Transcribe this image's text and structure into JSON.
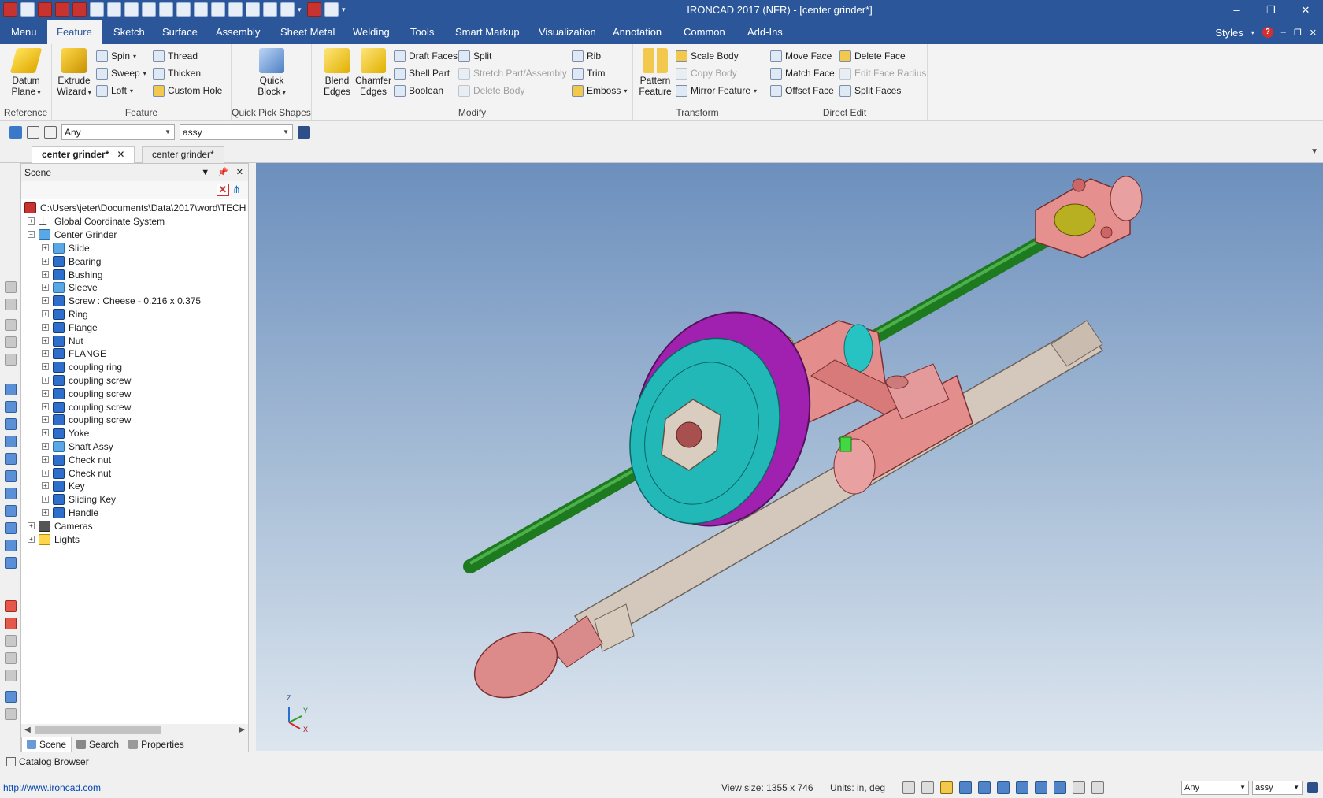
{
  "window": {
    "title": "IRONCAD 2017 (NFR) - [center grinder*]",
    "controls": [
      "–",
      "❐",
      "✕"
    ]
  },
  "ribbon_tabs": [
    "Menu",
    "Feature",
    "Sketch",
    "Surface",
    "Assembly",
    "Sheet Metal",
    "Welding",
    "Tools",
    "Smart Markup",
    "Visualization",
    "Annotation",
    "Common",
    "Add-Ins"
  ],
  "ribbon_right": {
    "styles": "Styles",
    "help": "?"
  },
  "ribbon": {
    "reference": {
      "label": "Reference",
      "datum_plane": "Datum Plane"
    },
    "feature": {
      "label": "Feature",
      "extrude_wizard": "Extrude Wizard",
      "spin": "Spin",
      "sweep": "Sweep",
      "loft": "Loft",
      "thread": "Thread",
      "thicken": "Thicken",
      "custom_hole": "Custom Hole"
    },
    "quick_pick": {
      "label": "Quick Pick Shapes",
      "quick_block": "Quick Block"
    },
    "modify": {
      "label": "Modify",
      "blend_edges": "Blend Edges",
      "chamfer_edges": "Chamfer Edges",
      "draft_faces": "Draft Faces",
      "shell_part": "Shell Part",
      "boolean": "Boolean",
      "split": "Split",
      "stretch": "Stretch Part/Assembly",
      "delete_body": "Delete Body",
      "rib": "Rib",
      "trim": "Trim",
      "emboss": "Emboss"
    },
    "transform": {
      "label": "Transform",
      "pattern_feature": "Pattern Feature",
      "scale_body": "Scale Body",
      "copy_body": "Copy Body",
      "mirror_feature": "Mirror Feature"
    },
    "direct_edit": {
      "label": "Direct Edit",
      "move_face": "Move Face",
      "match_face": "Match Face",
      "offset_face": "Offset Face",
      "delete_face": "Delete Face",
      "edit_face_radius": "Edit Face Radius",
      "split_faces": "Split Faces"
    }
  },
  "selection": {
    "filter": "Any",
    "scope": "assy"
  },
  "doc_tabs": [
    {
      "label": "center grinder*",
      "active": true
    },
    {
      "label": "center grinder*",
      "active": false
    }
  ],
  "scene_panel": {
    "title": "Scene",
    "root": "C:\\Users\\jeter\\Documents\\Data\\2017\\word\\TECH",
    "gcs": "Global Coordinate System",
    "assembly": "Center Grinder",
    "items": [
      "Slide",
      "Bearing",
      "Bushing",
      "Sleeve",
      "Screw : Cheese - 0.216 x 0.375",
      "Ring",
      "Flange",
      "Nut",
      "FLANGE",
      "coupling ring",
      "coupling screw",
      "coupling screw",
      "coupling screw",
      "coupling screw",
      "Yoke",
      "Shaft Assy",
      "Check nut",
      "Check nut",
      "Key",
      "Sliding Key",
      "Handle"
    ],
    "cameras": "Cameras",
    "lights": "Lights",
    "tabs": [
      "Scene",
      "Search",
      "Properties"
    ]
  },
  "catalog_browser": "Catalog Browser",
  "status": {
    "link": "http://www.ironcad.com",
    "view_size": "View size: 1355 x  746",
    "units": "Units: in, deg",
    "filter": "Any",
    "scope": "assy"
  },
  "axes": {
    "z": "Z",
    "y": "Y",
    "x": "X"
  },
  "colors": {
    "brand": "#2b579a",
    "shaft": "#1e7a1e",
    "body": "#e08a8a",
    "wheel": "#a020b0",
    "disc": "#20b8b8",
    "steel": "#cfc3b8"
  }
}
